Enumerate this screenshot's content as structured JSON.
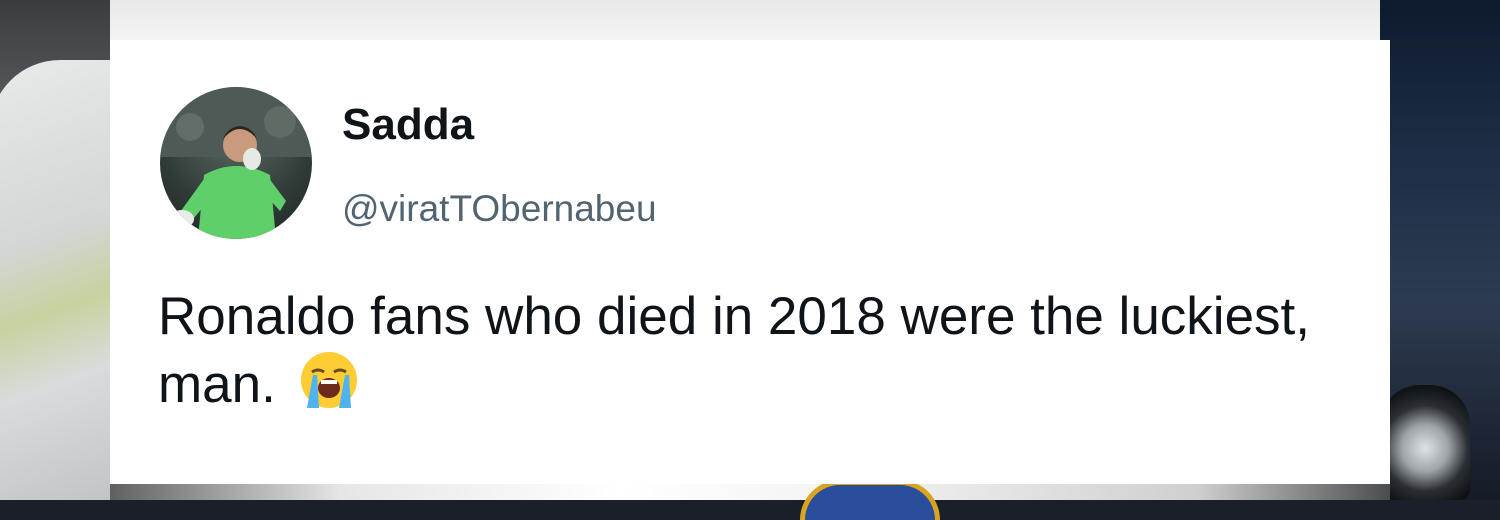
{
  "tweet": {
    "display_name": "Sadda",
    "handle": "@viratTObernabeu",
    "text": "Ronaldo fans who died in 2018 were the luckiest, man.",
    "emoji": "loudly-crying-face-icon",
    "avatar": "avatar-goalkeeper-in-green-kit"
  },
  "colors": {
    "name": "#0f1419",
    "handle": "#536471",
    "text": "#0f1419",
    "card_background": "#ffffff"
  }
}
